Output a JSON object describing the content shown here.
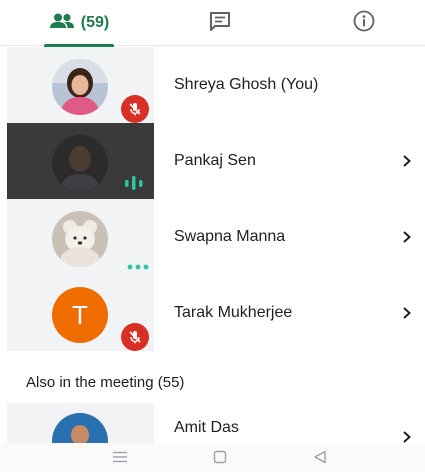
{
  "tabs": {
    "people_count": "(59)",
    "people_icon": "people-icon",
    "chat_icon": "chat-icon",
    "info_icon": "info-icon"
  },
  "participants": [
    {
      "name": "Shreya Ghosh (You)",
      "status": "muted"
    },
    {
      "name": "Pankaj Sen",
      "status": "speaking"
    },
    {
      "name": "Swapna Manna",
      "status": "more"
    },
    {
      "name": "Tarak Mukherjee",
      "status": "muted",
      "initial": "T"
    }
  ],
  "also_section": {
    "title": "Also in the meeting (55)",
    "first_name": "Amit Das"
  },
  "colors": {
    "accent": "#1e7d4e",
    "muted_badge": "#d93025",
    "speaking": "#2bc7a4",
    "letter_avatar": "#ef6c00"
  },
  "navbar": {
    "icons": [
      "menu-icon",
      "home-square-icon",
      "back-triangle-icon"
    ]
  }
}
